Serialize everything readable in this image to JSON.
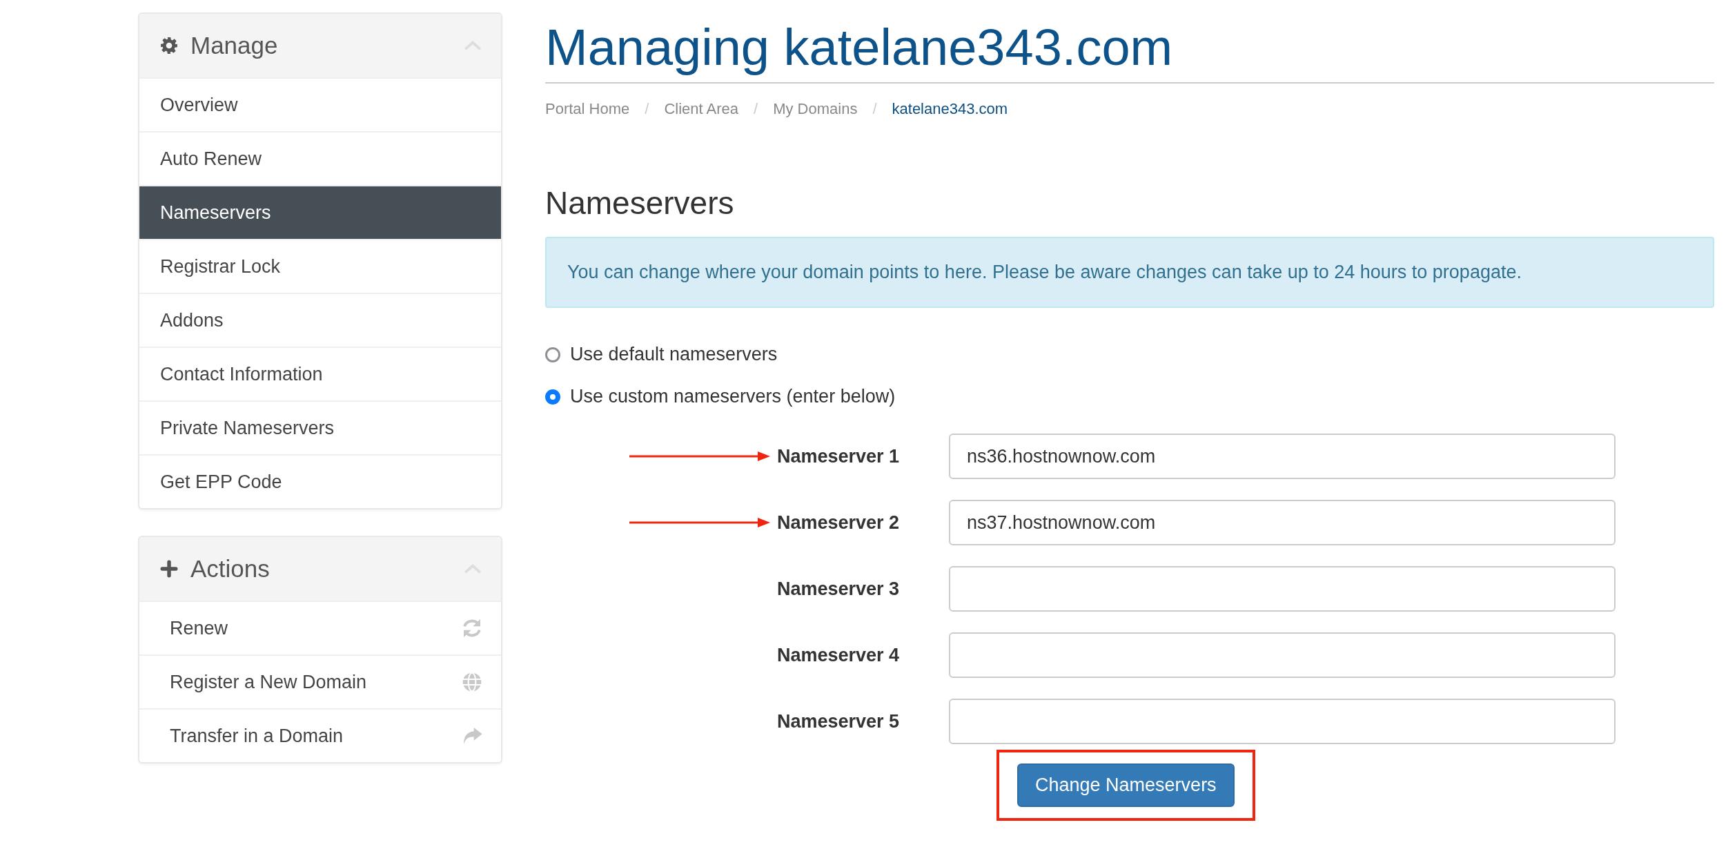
{
  "sidebar": {
    "panels": [
      {
        "kind": "gear",
        "title": "Manage",
        "items": [
          {
            "label": "Overview",
            "selected": false
          },
          {
            "label": "Auto Renew",
            "selected": false
          },
          {
            "label": "Nameservers",
            "selected": true
          },
          {
            "label": "Registrar Lock",
            "selected": false
          },
          {
            "label": "Addons",
            "selected": false
          },
          {
            "label": "Contact Information",
            "selected": false
          },
          {
            "label": "Private Nameservers",
            "selected": false
          },
          {
            "label": "Get EPP Code",
            "selected": false
          }
        ]
      },
      {
        "kind": "plus",
        "title": "Actions",
        "items": [
          {
            "label": "Renew",
            "kind": "refresh"
          },
          {
            "label": "Register a New Domain",
            "kind": "globe"
          },
          {
            "label": "Transfer in a Domain",
            "kind": "share"
          }
        ]
      }
    ]
  },
  "page": {
    "title": "Managing katelane343.com",
    "breadcrumb": [
      {
        "label": "Portal Home",
        "current": false
      },
      {
        "separator": "/",
        "label": "Client Area",
        "current": false
      },
      {
        "separator": "/",
        "label": "My Domains",
        "current": false
      },
      {
        "separator": "/",
        "label": "katelane343.com",
        "current": true
      }
    ],
    "section_title": "Nameservers",
    "info": "You can change where your domain points to here. Please be aware changes can take up to 24 hours to propagate.",
    "options": [
      {
        "label": "Use default nameservers",
        "selected": false
      },
      {
        "label": "Use custom nameservers (enter below)",
        "selected": true
      }
    ],
    "fields": [
      {
        "label": "Nameserver 1",
        "value": "ns36.hostnownow.com",
        "annotated": true
      },
      {
        "label": "Nameserver 2",
        "value": "ns37.hostnownow.com",
        "annotated": true
      },
      {
        "label": "Nameserver 3",
        "annotated": false
      },
      {
        "label": "Nameserver 4",
        "annotated": false
      },
      {
        "label": "Nameserver 5",
        "annotated": false
      }
    ],
    "submit": {
      "label": "Change Nameservers",
      "highlighted": true
    }
  }
}
